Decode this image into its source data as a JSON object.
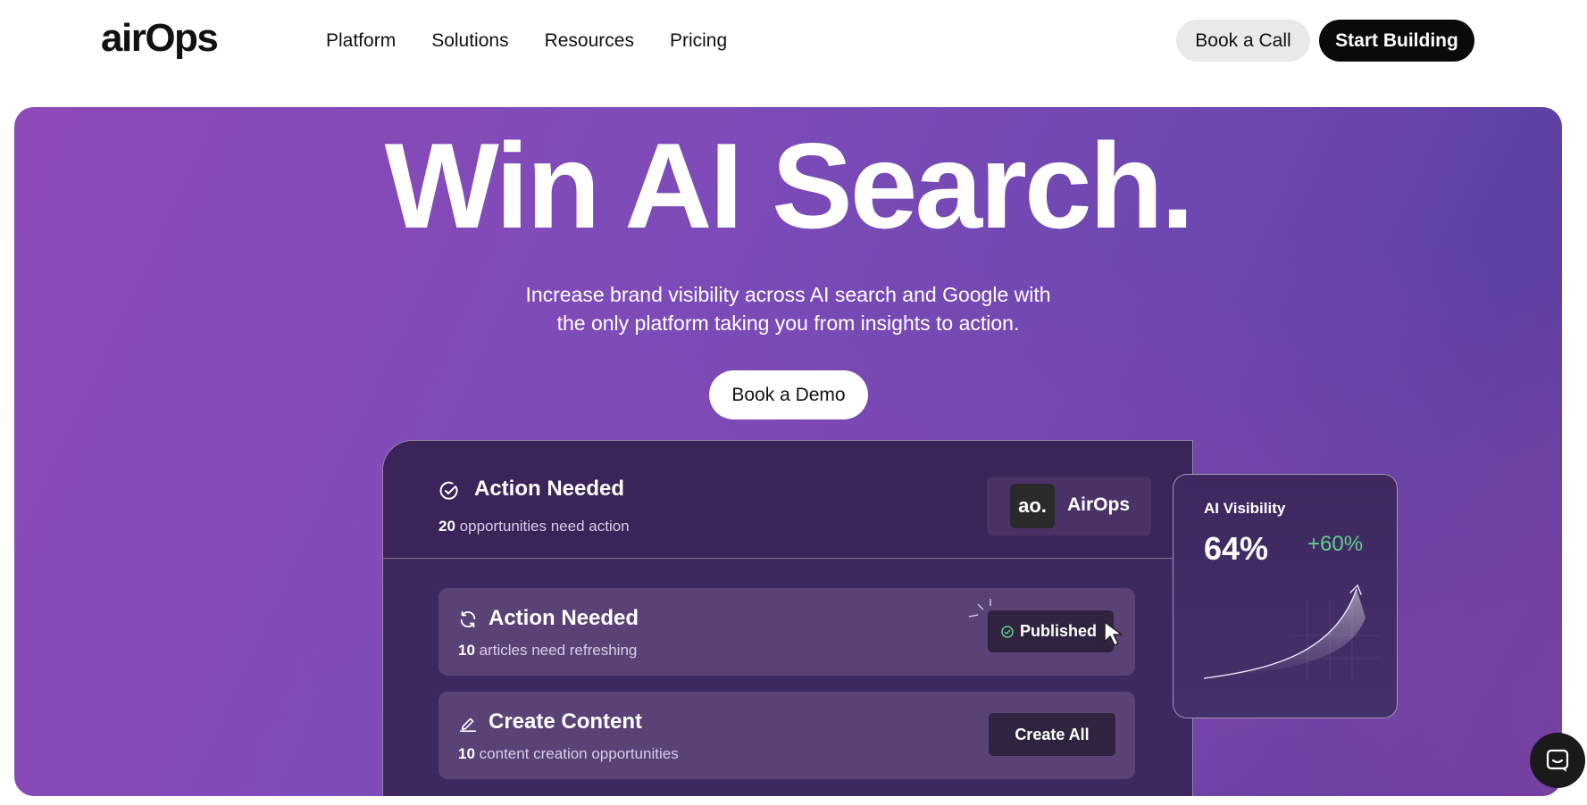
{
  "header": {
    "logo": "airOps",
    "nav": [
      "Platform",
      "Solutions",
      "Resources",
      "Pricing"
    ],
    "book_call": "Book a Call",
    "start_building": "Start Building"
  },
  "hero": {
    "title": "Win AI Search.",
    "subtitle_line1": "Increase brand visibility across AI search and Google with",
    "subtitle_line2": "the only platform taking you from insights to action.",
    "cta": "Book a Demo"
  },
  "panel": {
    "head_title": "Action Needed",
    "head_count": "20",
    "head_sub": "opportunities need action",
    "brand_logo": "ao.",
    "brand_name": "AirOps",
    "cards": [
      {
        "title": "Action Needed",
        "count": "10",
        "sub": "articles need refreshing",
        "action": "Published"
      },
      {
        "title": "Create Content",
        "count": "10",
        "sub": "content creation opportunities",
        "action": "Create All"
      }
    ]
  },
  "visibility": {
    "title": "AI Visibility",
    "value": "64%",
    "delta": "+60%"
  },
  "colors": {
    "accent_green": "#5fd08a",
    "hero_purple": "#7d4bb9"
  },
  "icons": [
    "check-circle-icon",
    "refresh-icon",
    "pencil-icon",
    "cursor-icon",
    "chat-icon"
  ]
}
